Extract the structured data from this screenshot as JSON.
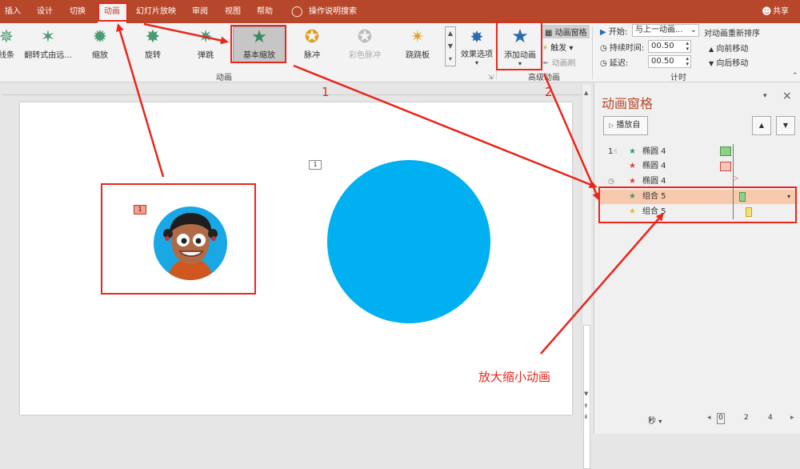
{
  "menu": {
    "items": [
      "插入",
      "设计",
      "切换",
      "动画",
      "幻灯片放映",
      "审阅",
      "视图",
      "帮助"
    ],
    "search": "操作说明搜索",
    "share": "共享"
  },
  "ribbon": {
    "animations": [
      "线条",
      "翻转式由远...",
      "缩放",
      "旋转",
      "弹跳",
      "基本缩放",
      "脉冲",
      "彩色脉冲",
      "跷跷板"
    ],
    "effect_options": "效果选项",
    "group_animation": "动画",
    "add_animation": "添加动画",
    "anim_pane": "动画窗格",
    "trigger": "触发",
    "anim_painter": "动画刷",
    "group_advanced": "高级动画",
    "start_label": "开始:",
    "start_value": "与上一动画...",
    "duration_label": "持续时间:",
    "duration_value": "00.50",
    "delay_label": "延迟:",
    "delay_value": "00.50",
    "reorder_title": "对动画重新排序",
    "move_earlier": "向前移动",
    "move_later": "向后移动",
    "group_timing": "计时"
  },
  "slide": {
    "tag1": "1",
    "tag2": "1"
  },
  "pane": {
    "title": "动画窗格",
    "play_label": "播放自",
    "rows": [
      {
        "num": "1",
        "name": "椭圆 4",
        "star": "#3a9a6a"
      },
      {
        "num": "",
        "name": "椭圆 4",
        "star": "#d04a35"
      },
      {
        "num": "",
        "name": "椭圆 4",
        "star": "#d04a35"
      },
      {
        "num": "",
        "name": "组合 5",
        "star": "#3a9a6a"
      },
      {
        "num": "",
        "name": "组合 5",
        "star": "#e6b93a"
      }
    ],
    "seconds_label": "秒",
    "scale": [
      "0",
      "2",
      "4"
    ]
  },
  "annotations": {
    "num1": "1",
    "num2": "2",
    "caption": "放大缩小动画"
  },
  "colors": {
    "accent": "#b7472a",
    "red": "#e8271d",
    "circle": "#00b0f0"
  }
}
